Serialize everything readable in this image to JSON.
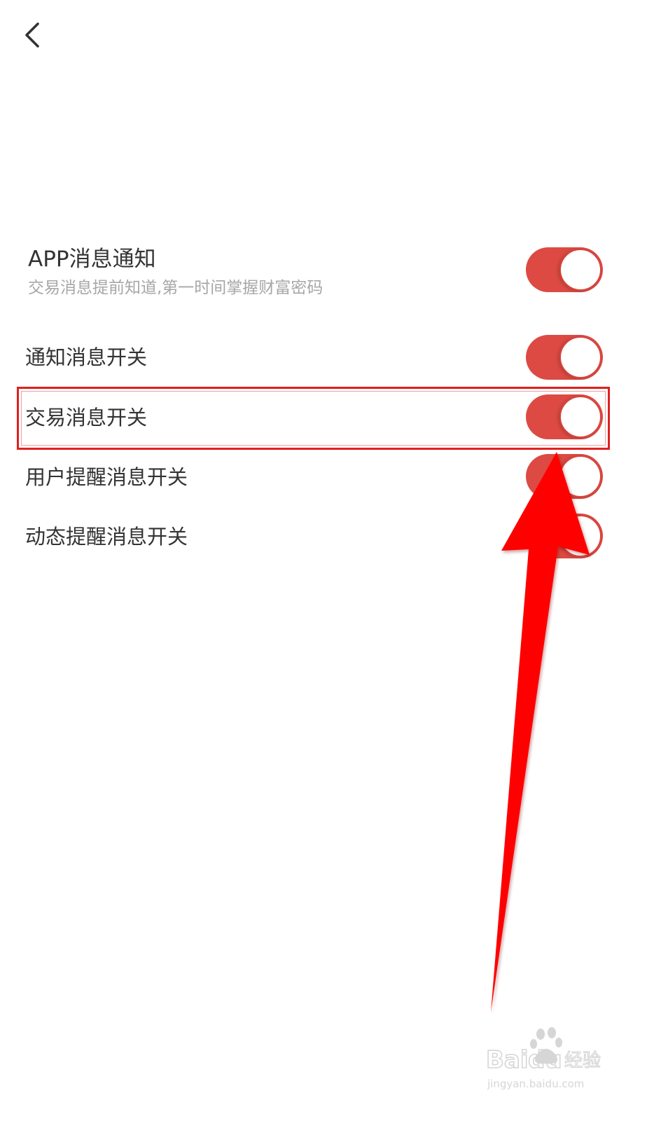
{
  "header": {
    "back_icon": "chevron-left-icon"
  },
  "settings": {
    "app_notification": {
      "title": "APP消息通知",
      "subtitle": "交易消息提前知道,第一时间掌握财富密码",
      "enabled": true
    },
    "items": [
      {
        "label": "通知消息开关",
        "enabled": true
      },
      {
        "label": "交易消息开关",
        "enabled": true
      },
      {
        "label": "用户提醒消息开关",
        "enabled": true
      },
      {
        "label": "动态提醒消息开关",
        "enabled": true
      }
    ]
  },
  "annotation": {
    "highlight_color": "#e02020",
    "arrow_color": "#ff0000",
    "highlighted_item": "交易消息开关"
  },
  "colors": {
    "toggle_on": "#dc4a43",
    "title_text": "#333333",
    "subtitle_text": "#a7a7a7"
  }
}
